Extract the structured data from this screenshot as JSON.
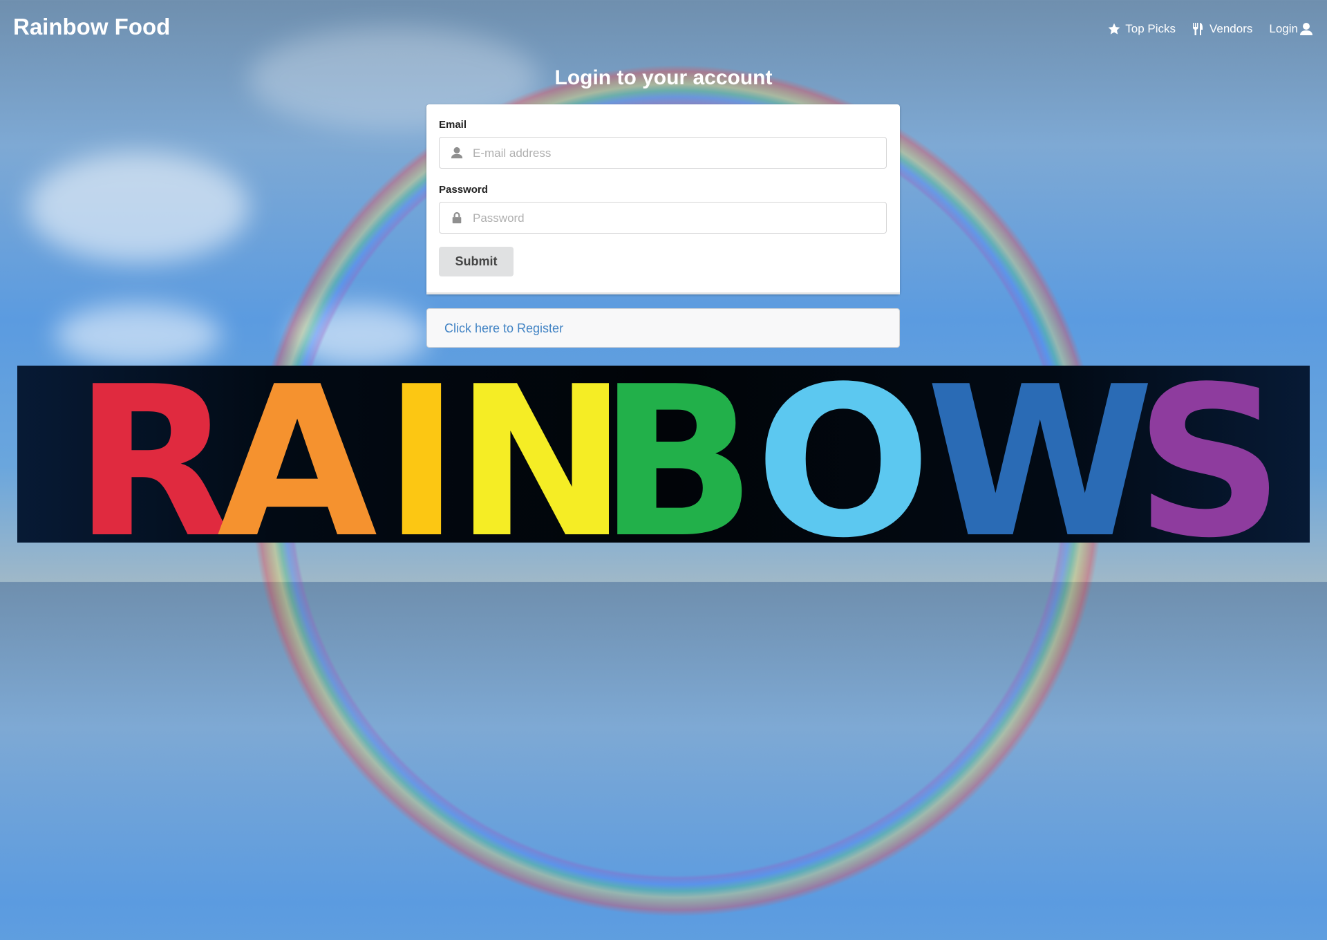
{
  "header": {
    "brand": "Rainbow Food"
  },
  "nav": [
    {
      "label": "Top Picks",
      "icon": "star-icon"
    },
    {
      "label": "Vendors",
      "icon": "utensils-icon"
    },
    {
      "label": "Login",
      "icon": "user-icon"
    }
  ],
  "login": {
    "title": "Login to your account",
    "email_label": "Email",
    "email_placeholder": "E-mail address",
    "email_value": "",
    "password_label": "Password",
    "password_placeholder": "Password",
    "password_value": "",
    "submit_label": "Submit",
    "register_link": "Click here to Register"
  },
  "banner": {
    "text": "RAINBOWS",
    "letter_colors": [
      "#e02a3f",
      "#f5922f",
      "#fcc713",
      "#f5ed25",
      "#22b04a",
      "#5cc8f0",
      "#2a6bb5",
      "#8e3c9e"
    ]
  },
  "colors": {
    "link": "#4183c4",
    "button_bg": "#e0e1e2"
  }
}
